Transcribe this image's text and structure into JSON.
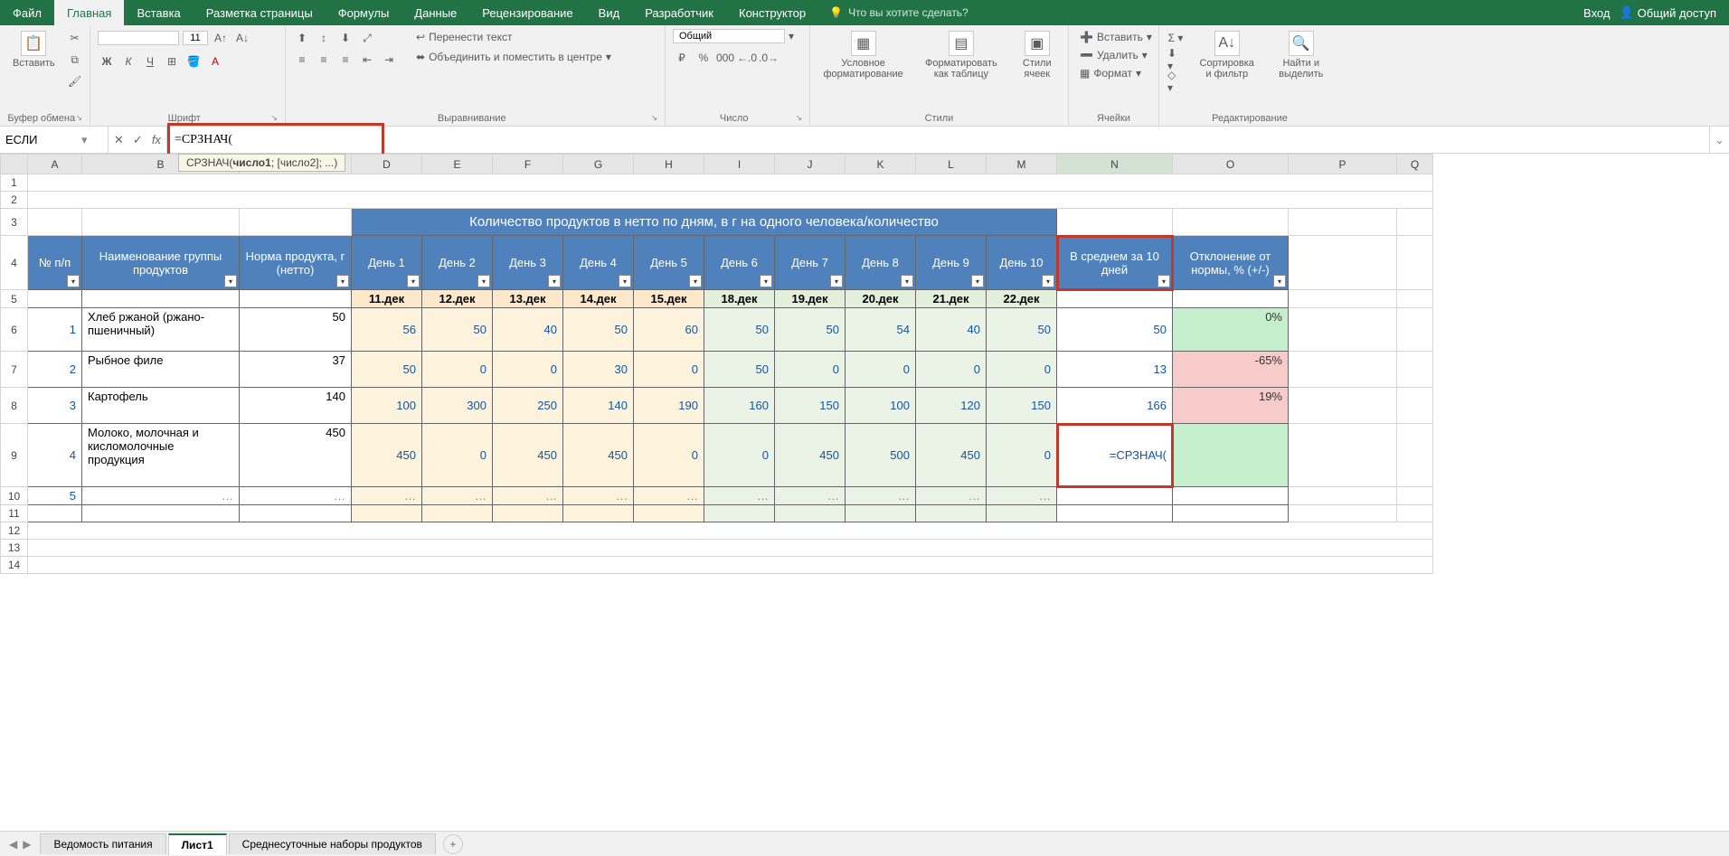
{
  "tabs": {
    "file": "Файл",
    "home": "Главная",
    "insert": "Вставка",
    "layout": "Разметка страницы",
    "formulas": "Формулы",
    "data": "Данные",
    "review": "Рецензирование",
    "view": "Вид",
    "developer": "Разработчик",
    "design": "Конструктор",
    "tell": "Что вы хотите сделать?",
    "login": "Вход",
    "share": "Общий доступ"
  },
  "ribbon": {
    "clipboard": {
      "paste": "Вставить",
      "label": "Буфер обмена"
    },
    "font": {
      "name": "",
      "size": "11",
      "bold": "Ж",
      "italic": "К",
      "underline": "Ч",
      "label": "Шрифт"
    },
    "align": {
      "wrap": "Перенести текст",
      "merge": "Объединить и поместить в центре",
      "label": "Выравнивание"
    },
    "number": {
      "fmt": "Общий",
      "label": "Число"
    },
    "styles": {
      "cond": "Условное форматирование",
      "table": "Форматировать как таблицу",
      "cell": "Стили ячеек",
      "label": "Стили"
    },
    "cells": {
      "insert": "Вставить",
      "delete": "Удалить",
      "format": "Формат",
      "label": "Ячейки"
    },
    "editing": {
      "sort": "Сортировка и фильтр",
      "find": "Найти и выделить",
      "label": "Редактирование"
    }
  },
  "fxbar": {
    "name": "ЕСЛИ",
    "formula": "=СРЗНАЧ(",
    "tooltip_fn": "СРЗНАЧ(",
    "tooltip_arg1": "число1",
    "tooltip_rest": "; [число2]; ...)"
  },
  "cols": [
    "",
    "A",
    "B",
    "C",
    "D",
    "E",
    "F",
    "G",
    "H",
    "I",
    "J",
    "K",
    "L",
    "M",
    "N",
    "O",
    "P",
    "Q"
  ],
  "table": {
    "merge_header": "Количество продуктов в нетто по дням, в г на одного человека/количество",
    "headers": {
      "num": "№ п/п",
      "name": "Наименование группы продуктов",
      "norm": "Норма продукта, г (нетто)",
      "days": [
        "День 1",
        "День 2",
        "День 3",
        "День 4",
        "День 5",
        "День 6",
        "День 7",
        "День 8",
        "День 9",
        "День 10"
      ],
      "avg": "В среднем за 10 дней",
      "dev": "Отклонение от нормы, % (+/-)"
    },
    "dates": [
      "11.дек",
      "12.дек",
      "13.дек",
      "14.дек",
      "15.дек",
      "18.дек",
      "19.дек",
      "20.дек",
      "21.дек",
      "22.дек"
    ],
    "rows": [
      {
        "n": "1",
        "name": "Хлеб ржаной (ржано-пшеничный)",
        "norm": "50",
        "v": [
          "56",
          "50",
          "40",
          "50",
          "60",
          "50",
          "50",
          "54",
          "40",
          "50"
        ],
        "avg": "50",
        "dev": "0%",
        "devc": "pctG"
      },
      {
        "n": "2",
        "name": "Рыбное филе",
        "norm": "37",
        "v": [
          "50",
          "0",
          "0",
          "30",
          "0",
          "50",
          "0",
          "0",
          "0",
          "0"
        ],
        "avg": "13",
        "dev": "-65%",
        "devc": "pctR"
      },
      {
        "n": "3",
        "name": "Картофель",
        "norm": "140",
        "v": [
          "100",
          "300",
          "250",
          "140",
          "190",
          "160",
          "150",
          "100",
          "120",
          "150"
        ],
        "avg": "166",
        "dev": "19%",
        "devc": "pctR"
      },
      {
        "n": "4",
        "name": "Молоко, молочная и кисломолочные продукция",
        "norm": "450",
        "v": [
          "450",
          "0",
          "450",
          "450",
          "0",
          "0",
          "450",
          "500",
          "450",
          "0"
        ],
        "avg": "=СРЗНАЧ(",
        "dev": "",
        "devc": "pctG"
      }
    ],
    "row5n": "5",
    "ellipsis": "…"
  },
  "sheets": {
    "s1": "Ведомость питания",
    "s2": "Лист1",
    "s3": "Среднесуточные наборы продуктов"
  }
}
